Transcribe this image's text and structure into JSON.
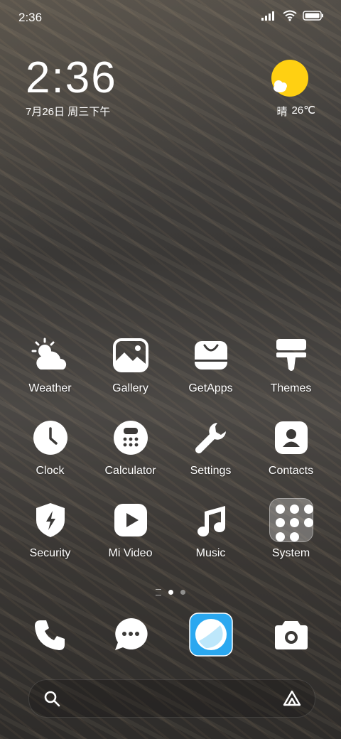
{
  "status_bar": {
    "time": "2:36"
  },
  "clock_widget": {
    "time": "2:36",
    "date": "7月26日 周三下午"
  },
  "weather_widget": {
    "condition": "晴",
    "temperature": "26℃",
    "sun_color": "#FFD012"
  },
  "apps": [
    {
      "label": "Weather",
      "icon": "weather-icon"
    },
    {
      "label": "Gallery",
      "icon": "gallery-icon"
    },
    {
      "label": "GetApps",
      "icon": "getapps-icon"
    },
    {
      "label": "Themes",
      "icon": "themes-icon"
    },
    {
      "label": "Clock",
      "icon": "clock-icon"
    },
    {
      "label": "Calculator",
      "icon": "calculator-icon"
    },
    {
      "label": "Settings",
      "icon": "settings-icon"
    },
    {
      "label": "Contacts",
      "icon": "contacts-icon"
    },
    {
      "label": "Security",
      "icon": "security-icon"
    },
    {
      "label": "Mi Video",
      "icon": "mi-video-icon"
    },
    {
      "label": "Music",
      "icon": "music-icon"
    },
    {
      "label": "System",
      "icon": "system-folder-icon"
    }
  ],
  "dock": [
    {
      "icon": "phone-icon"
    },
    {
      "icon": "messages-icon"
    },
    {
      "icon": "browser-icon",
      "accent": "#2BA8F0"
    },
    {
      "icon": "camera-icon"
    }
  ],
  "pager": {
    "pages": 2,
    "current": 1
  }
}
